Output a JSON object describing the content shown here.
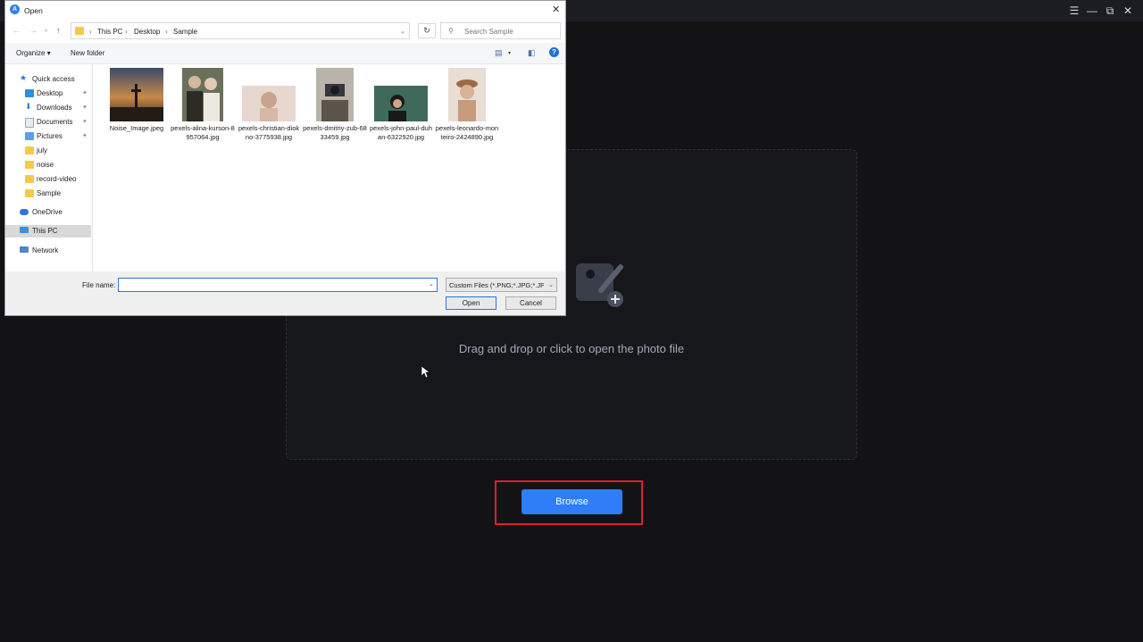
{
  "app": {
    "window_controls": [
      "menu-icon",
      "minimize-icon",
      "restore-icon",
      "close-icon"
    ],
    "drop_zone_text": "Drag and drop or click to open the photo file",
    "browse_label": "Browse",
    "accent_color": "#2d7ef7",
    "highlight_color": "#e01f26"
  },
  "dialog": {
    "title": "Open",
    "address": {
      "crumbs": [
        "This PC",
        "Desktop",
        "Sample"
      ],
      "separator": "›"
    },
    "search_placeholder": "Search Sample",
    "toolbar": {
      "organize": "Organize ▾",
      "new_folder": "New folder",
      "help": "?"
    },
    "sidebar": [
      {
        "label": "Quick access",
        "icon": "star-icon"
      },
      {
        "label": "Desktop",
        "icon": "desktop-icon",
        "pinned": true
      },
      {
        "label": "Downloads",
        "icon": "download-icon",
        "pinned": true
      },
      {
        "label": "Documents",
        "icon": "documents-icon",
        "pinned": true
      },
      {
        "label": "Pictures",
        "icon": "pictures-icon",
        "pinned": true
      },
      {
        "label": "july",
        "icon": "folder-icon"
      },
      {
        "label": "noise",
        "icon": "folder-icon"
      },
      {
        "label": "record-video",
        "icon": "folder-icon"
      },
      {
        "label": "Sample",
        "icon": "folder-icon"
      },
      {
        "label": "OneDrive",
        "icon": "cloud-icon"
      },
      {
        "label": "This PC",
        "icon": "computer-icon",
        "selected": true
      },
      {
        "label": "Network",
        "icon": "network-icon"
      }
    ],
    "files": [
      "Noise_Image.jpeg",
      "pexels-alina-kurson-8957064.jpg",
      "pexels-christian-diokno-3775938.jpg",
      "pexels-dmitriy-zub-6833459.jpg",
      "pexels-john-paul-duhan-6322920.jpg",
      "pexels-leonardo-monteiro-2424890.jpg"
    ],
    "file_name_label": "File name:",
    "file_name_value": "",
    "filter": "Custom Files (*.PNG;*.JPG;*.JPE",
    "open_label": "Open",
    "cancel_label": "Cancel"
  }
}
